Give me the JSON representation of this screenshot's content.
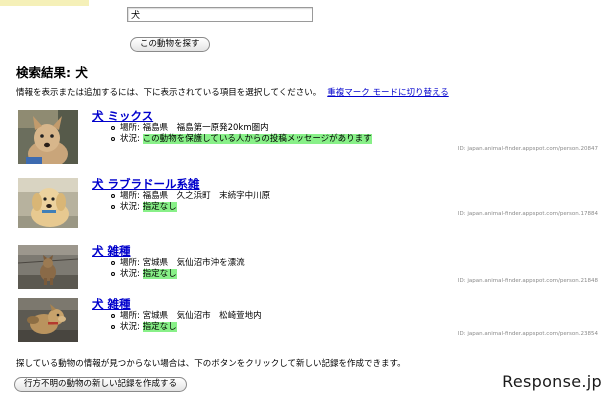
{
  "search": {
    "value": "犬",
    "button_label": "この動物を探す"
  },
  "results": {
    "title": "検索結果: 犬",
    "instructions": "情報を表示または追加するには、下に表示されている項目を選択してください。",
    "mode_link": "重複マーク モードに切り替える",
    "items": [
      {
        "title": "犬 ミックス",
        "location_label": "場所:",
        "location": "福島県　福島第一原発20km圏内",
        "status_label": "状況:",
        "status": "この動物を保護している人からの投稿メッセージがあります",
        "id": "ID: japan.animal-finder.appspot.com/person.20847"
      },
      {
        "title": "犬 ラブラドール系雑",
        "location_label": "場所:",
        "location": "福島県　久之浜町　末続字中川原",
        "status_label": "状況:",
        "status": "指定なし",
        "id": "ID: japan.animal-finder.appspot.com/person.17884"
      },
      {
        "title": "犬 雑種",
        "location_label": "場所:",
        "location": "宮城県　気仙沼市沖を漂流",
        "status_label": "状況:",
        "status": "指定なし",
        "id": "ID: japan.animal-finder.appspot.com/person.21848"
      },
      {
        "title": "犬 雑種",
        "location_label": "場所:",
        "location": "宮城県　気仙沼市　松崎萱地内",
        "status_label": "状況:",
        "status": "指定なし",
        "id": "ID: japan.animal-finder.appspot.com/person.23854"
      }
    ]
  },
  "footer": {
    "note": "探している動物の情報が見つからない場合は、下のボタンをクリックして新しい記録を作成できます。",
    "create_button": "行方不明の動物の新しい記録を作成する"
  },
  "watermark": "Response.jp",
  "colors": {
    "link": "#0000cc",
    "highlight": "#88f088"
  }
}
